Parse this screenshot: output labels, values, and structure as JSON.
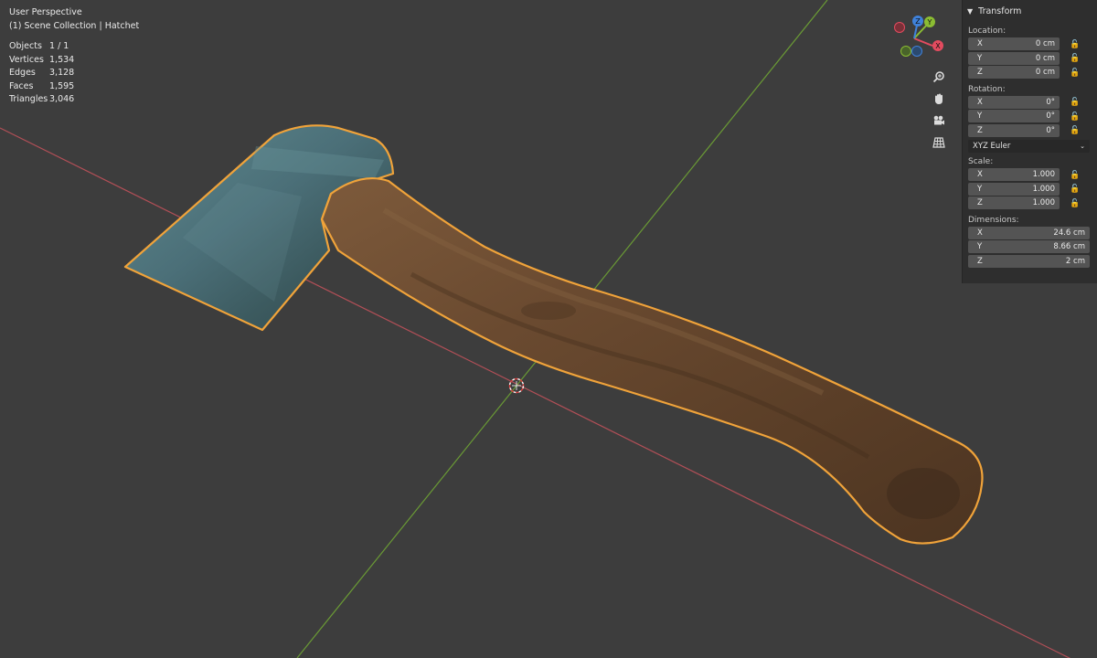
{
  "overlay": {
    "view_name": "User Perspective",
    "collection_path": "(1) Scene Collection | Hatchet",
    "stats": [
      {
        "label": "Objects",
        "value": "1 / 1"
      },
      {
        "label": "Vertices",
        "value": "1,534"
      },
      {
        "label": "Edges",
        "value": "3,128"
      },
      {
        "label": "Faces",
        "value": "1,595"
      },
      {
        "label": "Triangles",
        "value": "3,046"
      }
    ]
  },
  "gizmo": {
    "x_label": "X",
    "y_label": "Y",
    "z_label": "Z"
  },
  "nav_icons": [
    "zoom-icon",
    "hand-pan-icon",
    "camera-icon",
    "grid-icon"
  ],
  "colors": {
    "background": "#3d3d3d",
    "selection_outline": "#f0a33a",
    "x_axis": "#b24f57",
    "y_axis": "#6a9a35",
    "gizmo_x": "#e34b5f",
    "gizmo_y": "#8bbd33",
    "gizmo_z": "#3f82db"
  },
  "panel": {
    "title": "Transform",
    "location": {
      "label": "Location:",
      "fields": [
        {
          "axis": "X",
          "value": "0 cm"
        },
        {
          "axis": "Y",
          "value": "0 cm"
        },
        {
          "axis": "Z",
          "value": "0 cm"
        }
      ]
    },
    "rotation": {
      "label": "Rotation:",
      "fields": [
        {
          "axis": "X",
          "value": "0°"
        },
        {
          "axis": "Y",
          "value": "0°"
        },
        {
          "axis": "Z",
          "value": "0°"
        }
      ],
      "mode": "XYZ Euler"
    },
    "scale": {
      "label": "Scale:",
      "fields": [
        {
          "axis": "X",
          "value": "1.000"
        },
        {
          "axis": "Y",
          "value": "1.000"
        },
        {
          "axis": "Z",
          "value": "1.000"
        }
      ]
    },
    "dimensions": {
      "label": "Dimensions:",
      "fields": [
        {
          "axis": "X",
          "value": "24.6 cm"
        },
        {
          "axis": "Y",
          "value": "8.66 cm"
        },
        {
          "axis": "Z",
          "value": "2 cm"
        }
      ]
    }
  }
}
